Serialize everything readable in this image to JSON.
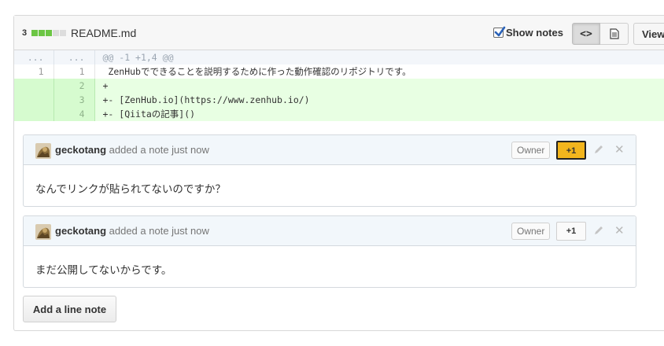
{
  "file": {
    "diffstat_count": "3",
    "diffstat_blocks": [
      "#6cc644",
      "#6cc644",
      "#6cc644",
      "#dddddd",
      "#dddddd"
    ],
    "name": "README.md",
    "show_notes_label": "Show notes",
    "show_notes_checked": true,
    "view_toggle": [
      "code-icon",
      "file-text-icon"
    ],
    "view_label": "View"
  },
  "diff": {
    "hunk": {
      "old": "...",
      "new": "...",
      "text": "@@ -1 +1,4 @@"
    },
    "lines": [
      {
        "type": "context",
        "old": "1",
        "new": "1",
        "text": " ZenHubでできることを説明するために作った動作確認のリポジトリです。"
      },
      {
        "type": "add",
        "old": "",
        "new": "2",
        "text": "+"
      },
      {
        "type": "add",
        "old": "",
        "new": "3",
        "text": "+- [ZenHub.io](https://www.zenhub.io/)"
      },
      {
        "type": "add",
        "old": "",
        "new": "4",
        "text": "+- [Qiitaの記事]()"
      }
    ]
  },
  "notes": [
    {
      "user": "geckotang",
      "action": "added a note just now",
      "owner_label": "Owner",
      "plus_label": "+1",
      "plus_active": true,
      "body": "なんでリンクが貼られてないのですか？"
    },
    {
      "user": "geckotang",
      "action": "added a note just now",
      "owner_label": "Owner",
      "plus_label": "+1",
      "plus_active": false,
      "body": "まだ公開してないからです。"
    }
  ],
  "add_line_note_label": "Add a line note",
  "colors": {
    "added_bg": "#e8ffe3",
    "plus_one_active": "#f2b51d",
    "note_header_bg": "#f2f7fb"
  }
}
